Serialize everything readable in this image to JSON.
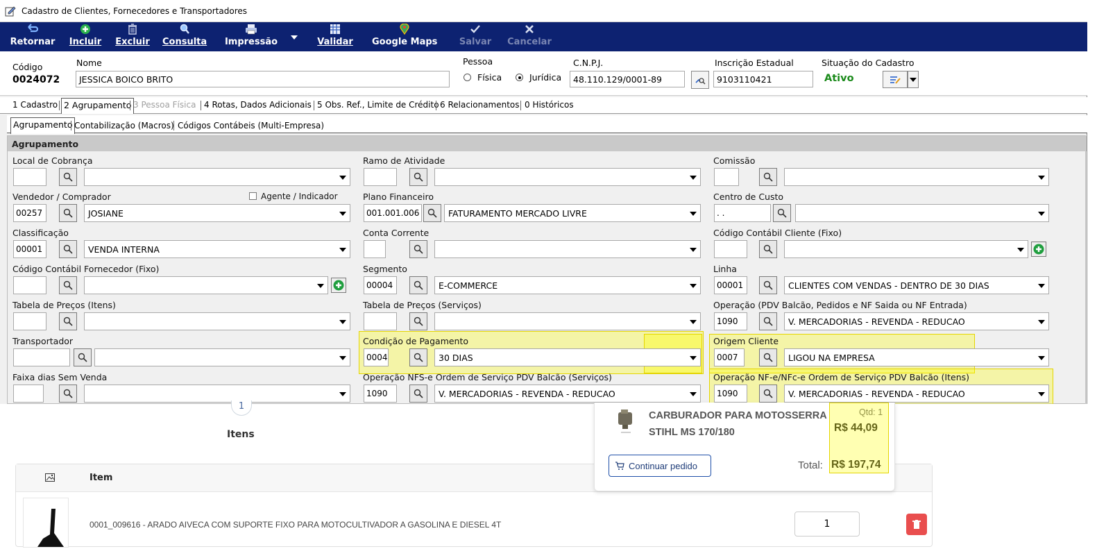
{
  "window": {
    "title": "Cadastro de Clientes, Fornecedores e Transportadores"
  },
  "toolbar": {
    "retornar": "Retornar",
    "incluir": "Incluir",
    "excluir": "Excluir",
    "consulta": "Consulta",
    "impressao": "Impressão",
    "validar": "Validar",
    "google_maps": "Google Maps",
    "salvar": "Salvar",
    "cancelar": "Cancelar"
  },
  "header": {
    "codigo_label": "Código",
    "codigo_value": "0024072",
    "nome_label": "Nome",
    "nome_value": "JESSICA BOICO BRITO",
    "pessoa_label": "Pessoa",
    "fisica": "Física",
    "juridica": "Jurídica",
    "cnpj_label": "C.N.P.J.",
    "cnpj_value": "48.110.129/0001-89",
    "ie_label": "Inscrição Estadual",
    "ie_value": "9103110421",
    "situacao_label": "Situação do Cadastro",
    "situacao_value": "Ativo",
    "situacao_color": "#1a8a1a"
  },
  "tabs": [
    "1 Cadastro",
    "2 Agrupamento",
    "3 Pessoa Física",
    "4 Rotas, Dados Adicionais",
    "5 Obs. Ref., Limite de Crédito",
    "6 Relacionamentos",
    "0 Históricos"
  ],
  "subtabs": [
    "Agrupamento",
    "Contabilização (Macros)",
    "Códigos Contábeis (Multi-Empresa)"
  ],
  "panel": {
    "title": "Agrupamento",
    "agente_label": "Agente / Indicador",
    "fields": {
      "local_cobranca": {
        "label": "Local de Cobrança",
        "code": "",
        "value": ""
      },
      "ramo_atividade": {
        "label": "Ramo de Atividade",
        "code": "",
        "value": ""
      },
      "comissao": {
        "label": "Comissão",
        "code": "",
        "value": ""
      },
      "vendedor": {
        "label": "Vendedor / Comprador",
        "code": "00257",
        "value": "JOSIANE"
      },
      "plano_financeiro": {
        "label": "Plano Financeiro",
        "code": "001.001.006",
        "value": "FATURAMENTO MERCADO LIVRE"
      },
      "centro_custo": {
        "label": "Centro de Custo",
        "code": " .  . ",
        "value": ""
      },
      "classificacao": {
        "label": "Classificação",
        "code": "00001",
        "value": "VENDA INTERNA"
      },
      "conta_corrente": {
        "label": "Conta Corrente",
        "code": "",
        "value": ""
      },
      "cod_contabil_cliente": {
        "label": "Código Contábil Cliente (Fixo)",
        "code": "",
        "value": ""
      },
      "cod_contabil_fornecedor": {
        "label": "Código Contábil Fornecedor (Fixo)",
        "code": "",
        "value": ""
      },
      "segmento": {
        "label": "Segmento",
        "code": "00004",
        "value": "E-COMMERCE"
      },
      "linha": {
        "label": "Linha",
        "code": "00001",
        "value": "CLIENTES COM VENDAS - DENTRO DE 30 DIAS"
      },
      "tabela_precos_itens": {
        "label": "Tabela de Preços (Itens)",
        "code": "",
        "value": ""
      },
      "tabela_precos_servicos": {
        "label": "Tabela de Preços (Serviços)",
        "code": "",
        "value": ""
      },
      "operacao_pdv": {
        "label": "Operação (PDV Balcão, Pedidos e NF Saida ou NF Entrada)",
        "code": "1090",
        "value": "V. MERCADORIAS - REVENDA - REDUCAO"
      },
      "transportador": {
        "label": "Transportador",
        "code": "",
        "value": ""
      },
      "condicao_pagamento": {
        "label": "Condição de Pagamento",
        "code": "0004",
        "value": "30 DIAS"
      },
      "origem_cliente": {
        "label": "Origem Cliente",
        "code": "0007",
        "value": "LIGOU NA EMPRESA"
      },
      "faixa_dias": {
        "label": "Faixa dias Sem Venda",
        "code": "",
        "value": ""
      },
      "operacao_nfse": {
        "label": "Operação NFS-e Ordem de Serviço PDV Balcão (Serviços)",
        "code": "1090",
        "value": "V. MERCADORIAS - REVENDA - REDUCAO"
      },
      "operacao_nfe": {
        "label": "Operação NF-e/NFc-e Ordem de Serviço PDV Balcão (Itens)",
        "code": "1090",
        "value": "V. MERCADORIAS - REVENDA - REDUCAO"
      }
    }
  },
  "shop": {
    "step_number": "1",
    "step_label": "Itens",
    "table_header_item": "Item",
    "row_description": "0001_009616 - ARADO AIVECA COM SUPORTE FIXO PARA MOTOCULTIVADOR A GASOLINA E DIESEL 4T",
    "row_qty": "1",
    "popup": {
      "product_name": "CARBURADOR PARA MOTOSSERRA STIHL MS 170/180",
      "qty_label": "Qtd: 1",
      "price": "R$ 44,09",
      "continue_button": "Continuar pedido",
      "total_label": "Total:",
      "total_value": "R$ 197,74"
    }
  }
}
